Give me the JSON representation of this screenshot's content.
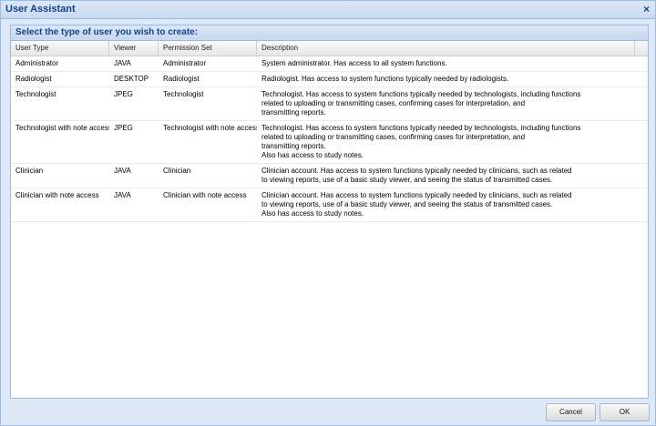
{
  "window": {
    "title": "User Assistant",
    "close_symbol": "×"
  },
  "panel": {
    "title": "Select the type of user you wish to create:"
  },
  "columns": [
    "User Type",
    "Viewer",
    "Permission Set",
    "Description"
  ],
  "rows": [
    {
      "user_type": "Administrator",
      "viewer": "JAVA",
      "permission_set": "Administrator",
      "description": "System administrator. Has access to all system functions."
    },
    {
      "user_type": "Radiologist",
      "viewer": "DESKTOP",
      "permission_set": "Radiologist",
      "description": "Radiologist. Has access to system functions typically needed by radiologists."
    },
    {
      "user_type": "Technologist",
      "viewer": "JPEG",
      "permission_set": "Technologist",
      "description": "Technologist. Has access to system functions typically needed by technologists, including functions\nrelated to uploading or transmitting cases, confirming cases for interpretation, and\ntransmitting reports."
    },
    {
      "user_type": "Technologist with note access",
      "viewer": "JPEG",
      "permission_set": "Technologist with note access",
      "description": "Technologist. Has access to system functions typically needed by technologists, including functions\nrelated to uploading or transmitting cases, confirming cases for interpretation, and\ntransmitting reports.\nAlso has access to study notes."
    },
    {
      "user_type": "Clinician",
      "viewer": "JAVA",
      "permission_set": "Clinician",
      "description": "Clinician account. Has access to system functions typically needed by clinicians, such as related\nto viewing reports, use of a basic study viewer, and seeing the status of transmitted cases."
    },
    {
      "user_type": "Clinician with note access",
      "viewer": "JAVA",
      "permission_set": "Clinician with note access",
      "description": "Clinician account. Has access to system functions typically needed by clinicians, such as related\nto viewing reports, use of a basic study viewer, and seeing the status of transmitted cases.\nAlso has access to study notes."
    }
  ],
  "buttons": {
    "cancel": "Cancel",
    "ok": "OK"
  }
}
